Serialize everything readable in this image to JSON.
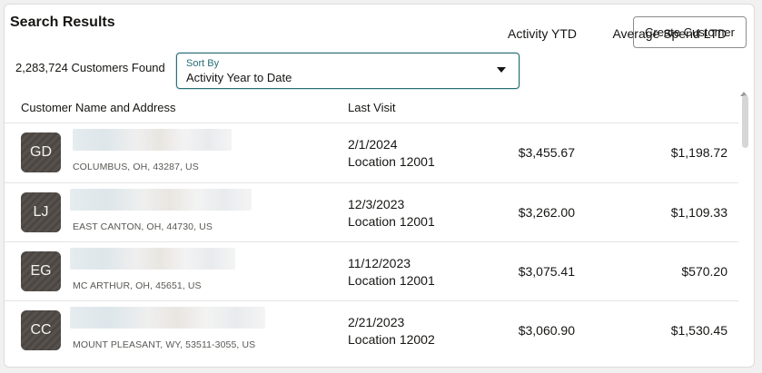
{
  "header": {
    "title": "Search Results",
    "create_button": "Create Customer"
  },
  "summary": {
    "count_text": "2,283,724 Customers Found"
  },
  "sort": {
    "label": "Sort By",
    "value": "Activity Year to Date"
  },
  "table": {
    "columns": {
      "name": "Customer Name and Address",
      "last_visit": "Last Visit",
      "ytd": "Activity YTD",
      "ltd": "Average Spend LTD"
    },
    "rows": [
      {
        "initials": "GD",
        "address": "COLUMBUS, OH, 43287, US",
        "visit_date": "2/1/2024",
        "visit_location": "Location 12001",
        "ytd": "$3,455.67",
        "ltd": "$1,198.72"
      },
      {
        "initials": "LJ",
        "address": "EAST CANTON, OH, 44730, US",
        "visit_date": "12/3/2023",
        "visit_location": "Location 12001",
        "ytd": "$3,262.00",
        "ltd": "$1,109.33"
      },
      {
        "initials": "EG",
        "address": "MC ARTHUR, OH, 45651, US",
        "visit_date": "11/12/2023",
        "visit_location": "Location 12001",
        "ytd": "$3,075.41",
        "ltd": "$570.20"
      },
      {
        "initials": "CC",
        "address": "MOUNT PLEASANT, WY, 53511-3055, US",
        "visit_date": "2/21/2023",
        "visit_location": "Location 12002",
        "ytd": "$3,060.90",
        "ltd": "$1,530.45"
      }
    ]
  },
  "colors": {
    "accent": "#2b6d76",
    "avatar": "#4f4a45"
  }
}
